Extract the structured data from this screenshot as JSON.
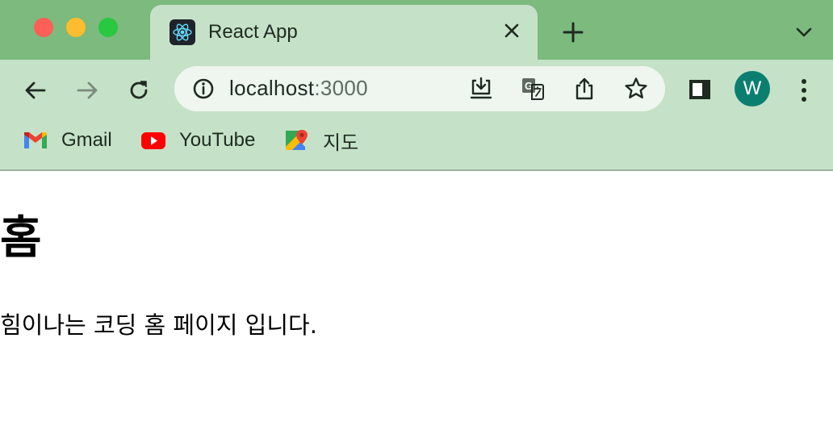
{
  "window": {
    "controls": [
      "close",
      "minimize",
      "maximize"
    ]
  },
  "tab": {
    "title": "React App",
    "favicon": "react-logo-icon"
  },
  "toolbar": {
    "url_host": "localhost",
    "url_port": ":3000",
    "profile_initial": "W"
  },
  "bookmarks": [
    {
      "label": "Gmail",
      "icon": "gmail-icon"
    },
    {
      "label": "YouTube",
      "icon": "youtube-icon"
    },
    {
      "label": "지도",
      "icon": "maps-icon"
    }
  ],
  "page": {
    "heading": "홈",
    "paragraph": "힘이나는 코딩 홈 페이지 입니다."
  },
  "colors": {
    "titlebar": "#7cba7e",
    "toolbar": "#c5e2c8",
    "omnibox": "#eef6ef",
    "avatar": "#0b7f6f"
  }
}
